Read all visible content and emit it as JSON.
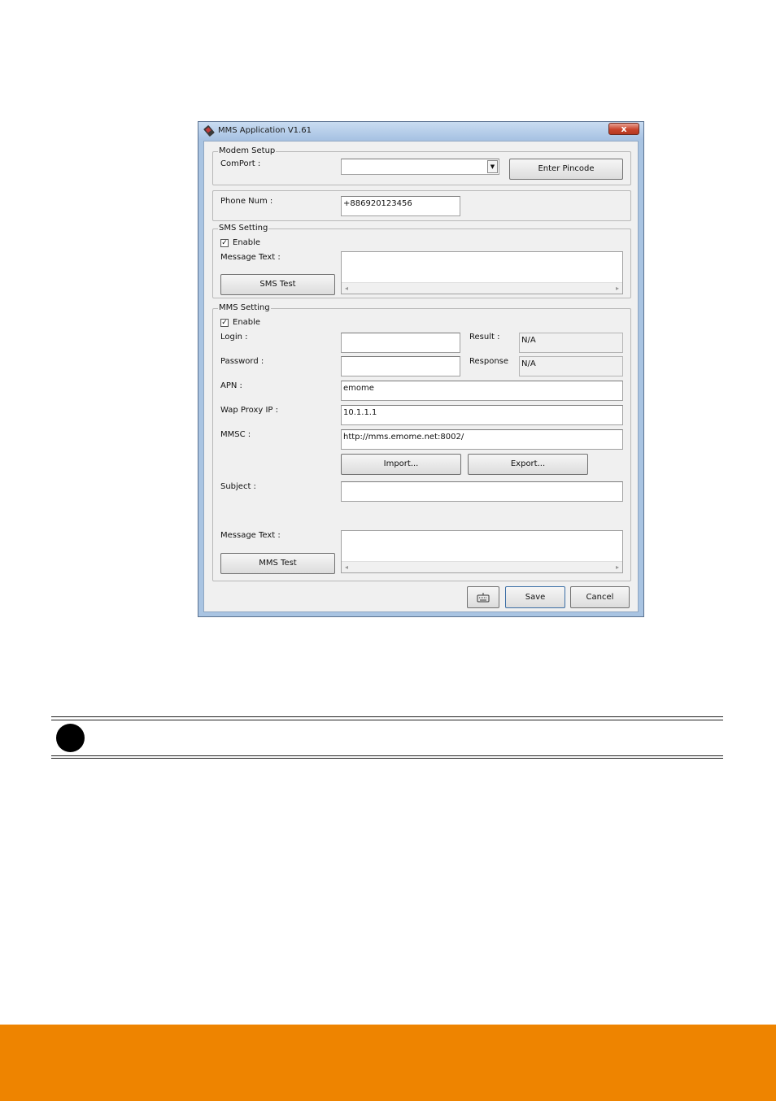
{
  "window": {
    "title": "MMS Application V1.61",
    "close_label": "x"
  },
  "modem_setup": {
    "group_label": "Modem Setup",
    "comport_label": "ComPort :",
    "comport_value": "",
    "enter_pincode_label": "Enter Pincode"
  },
  "phone": {
    "label": "Phone Num :",
    "value": "+886920123456"
  },
  "sms_setting": {
    "group_label": "SMS Setting",
    "enable_label": "Enable",
    "enable_checked": true,
    "message_text_label": "Message Text :",
    "message_text_value": "",
    "sms_test_label": "SMS Test"
  },
  "mms_setting": {
    "group_label": "MMS Setting",
    "enable_label": "Enable",
    "enable_checked": true,
    "login_label": "Login :",
    "login_value": "",
    "password_label": "Password :",
    "password_value": "",
    "result_label": "Result :",
    "result_value": "N/A",
    "response_label": "Response",
    "response_value": "N/A",
    "apn_label": "APN :",
    "apn_value": "emome",
    "wap_proxy_label": "Wap Proxy IP :",
    "wap_proxy_value": "10.1.1.1",
    "mmsc_label": "MMSC :",
    "mmsc_value": "http://mms.emome.net:8002/",
    "import_label": "Import...",
    "export_label": "Export...",
    "subject_label": "Subject :",
    "subject_value": "",
    "message_text_label": "Message Text :",
    "message_text_value": "",
    "mms_test_label": "MMS Test"
  },
  "bottom_buttons": {
    "keyboard_icon": "keyboard-icon",
    "save_label": "Save",
    "cancel_label": "Cancel"
  },
  "colors": {
    "footer_bar": "#ee8400",
    "close_button": "#c9452c"
  }
}
